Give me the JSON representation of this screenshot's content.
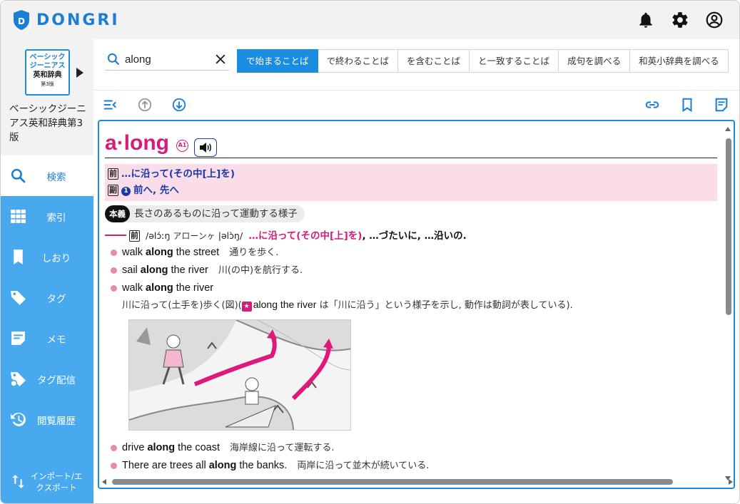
{
  "app": {
    "logo_text": "DONGRI"
  },
  "sidebar": {
    "dictionary": {
      "cover_line1": "ベーシック",
      "cover_line2": "ジーニアス",
      "cover_line3": "英和辞典",
      "cover_line4": "第3版",
      "title": "ベーシックジーニアス英和辞典第3版"
    },
    "items": [
      {
        "label": "検索",
        "icon": "search-icon"
      },
      {
        "label": "索引",
        "icon": "grid-icon"
      },
      {
        "label": "しおり",
        "icon": "bookmark-icon"
      },
      {
        "label": "タグ",
        "icon": "tag-icon"
      },
      {
        "label": "メモ",
        "icon": "memo-icon"
      },
      {
        "label": "タグ配信",
        "icon": "tag-share-icon"
      },
      {
        "label": "閲覧履歴",
        "icon": "history-icon"
      },
      {
        "label": "インポート/エクスポート",
        "icon": "import-export-icon"
      }
    ]
  },
  "search": {
    "value": "along"
  },
  "tabs": [
    {
      "label": "で始まることば",
      "active": true
    },
    {
      "label": "で終わることば"
    },
    {
      "label": "を含むことば"
    },
    {
      "label": "と一致することば"
    },
    {
      "label": "成句を調べる"
    },
    {
      "label": "和英小辞典を調べる"
    }
  ],
  "entry": {
    "headword": "a·long",
    "level": "A1",
    "summary": [
      {
        "pos": "前",
        "text": "…に沿って(その中[上]を)"
      },
      {
        "pos": "副",
        "num": "1",
        "text": "前へ, 先へ"
      }
    ],
    "core_tag": "本義",
    "core_text": "長さのあるものに沿って運動する様子",
    "sense_pos": "前",
    "pronunciation": "/əlɔ́ːŋ",
    "kana": "アローンヶ",
    "pronunciation_us": "|əlɔ̀ŋ/",
    "sense_def": "…に沿って(その中[上]を)",
    "sense_rest": ", …づたいに, …沿いの.",
    "examples": [
      {
        "pre": "walk ",
        "bold": "along",
        "post": " the street",
        "jp": "通りを歩く."
      },
      {
        "pre": "sail ",
        "bold": "along",
        "post": " the river",
        "jp": "川(の中)を航行する."
      },
      {
        "pre": "walk ",
        "bold": "along",
        "post": " the river",
        "jp": ""
      }
    ],
    "note_pre": "川に沿って(土手を)歩く(図)(",
    "note_star": "★",
    "note_en": "along the river",
    "note_post": " は「川に沿う」という様子を示し, 動作は動詞が表している).",
    "examples2": [
      {
        "pre": "drive ",
        "bold": "along",
        "post": " the coast",
        "jp": "海岸線に沿って運転する."
      },
      {
        "pre": "There are trees all ",
        "bold": "along",
        "post": " the banks.",
        "jp": "両岸に沿って並木が続いている."
      }
    ]
  },
  "colors": {
    "accent": "#1a8de0",
    "sidebar": "#48a9ee",
    "headword": "#d81b7a",
    "summary_bg": "#fadde8"
  }
}
